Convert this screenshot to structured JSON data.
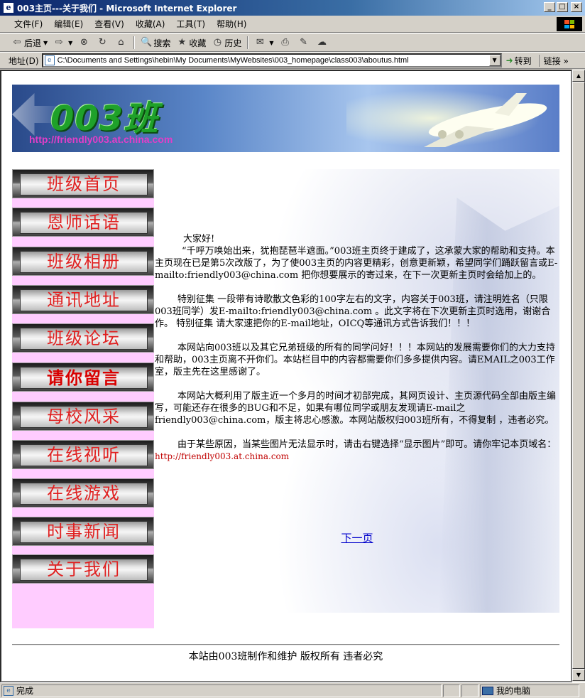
{
  "window": {
    "title": "003主页---关于我们 - Microsoft Internet Explorer",
    "minimize": "_",
    "maximize": "□",
    "close": "×"
  },
  "menu": [
    "文件(F)",
    "编辑(E)",
    "查看(V)",
    "收藏(A)",
    "工具(T)",
    "帮助(H)"
  ],
  "toolbar": {
    "back": "后退",
    "search": "搜索",
    "favorites": "收藏",
    "history": "历史"
  },
  "address": {
    "label": "地址(D)",
    "url": "C:\\Documents and Settings\\hebin\\My Documents\\MyWebsites\\003_homepage\\class003\\aboutus.html",
    "go": "转到",
    "links": "链接 »"
  },
  "banner": {
    "logo": "003班",
    "domain": "http://friendly003.at.china.com"
  },
  "nav": [
    {
      "label": "班级首页"
    },
    {
      "label": "恩师话语"
    },
    {
      "label": "班级相册"
    },
    {
      "label": "通讯地址"
    },
    {
      "label": "班级论坛"
    },
    {
      "label": "请你留言"
    },
    {
      "label": "母校风采"
    },
    {
      "label": "在线视听"
    },
    {
      "label": "在线游戏"
    },
    {
      "label": "时事新闻"
    },
    {
      "label": "关于我们"
    }
  ],
  "content": {
    "greeting": "大家好!",
    "p1": "“千呼万唤始出来，犹抱琵琶半遮面。”003班主页终于建成了，这承蒙大家的帮助和支持。本主页现在已是第5次改版了，为了使003主页的内容更精彩，创意更新颖，希望同学们踊跃留言或E-mailto:friendly003@china.com 把你想要展示的寄过来，在下一次更新主页时会给加上的。",
    "p2": "特别征集  一段带有诗歌散文色彩的100字左右的文字，内容关于003班，请注明姓名（只限003班同学）发E-mailto:friendly003@china.com 。此文字将在下次更新主页时选用，谢谢合作。  特别征集  请大家速把你的E-mail地址，OICQ等通讯方式告诉我们！！！",
    "p3": "本网站向003班以及其它兄弟班级的所有的同学问好！！！本网站的发展需要你们的大力支持和帮助，003主页离不开你们。本站栏目中的内容都需要你们多多提供内容。请EMAIL之003工作室，版主先在这里感谢了。",
    "p4": "本网站大概利用了版主近一个多月的时间才初部完成，其网页设计、主页源代码全部由版主编写，可能还存在很多的BUG和不足，如果有哪位同学或朋友发现请E-mail之friendly003@china.com，版主将忠心感激。本网站版权归003班所有，不得复制 ，违者必究。",
    "p5": "由于某些原因，当某些图片无法显示时，请击右键选择“显示图片”即可。请你牢记本页域名：",
    "p5_domain": "http://friendly003.at.china.com",
    "next": "下一页"
  },
  "footer": "本站由003班制作和维护 版权所有 违者必究",
  "status": {
    "text": "完成",
    "zone": "我的电脑"
  }
}
